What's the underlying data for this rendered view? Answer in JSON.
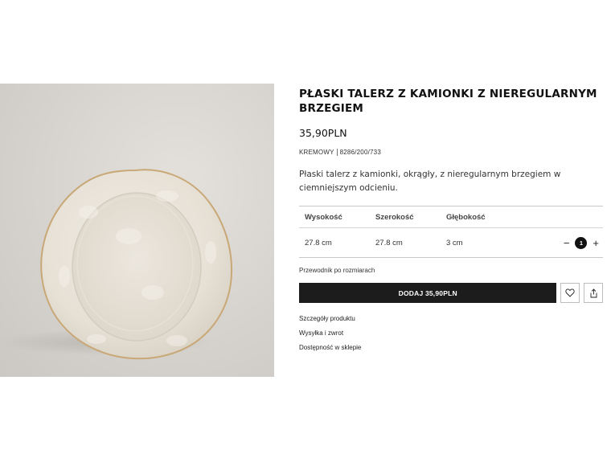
{
  "product": {
    "title": "PŁASKI TALERZ Z KAMIONKI Z NIEREGULARNYM BRZEGIEM",
    "price": "35,90PLN",
    "color": "KREMOWY",
    "reference": "8286/200/733",
    "description": "Płaski talerz z kamionki, okrągły, z nieregularnym brzegiem w ciemniejszym odcieniu."
  },
  "dimensions": {
    "headers": [
      "Wysokość",
      "Szerokość",
      "Głębokość"
    ],
    "values": [
      "27.8 cm",
      "27.8 cm",
      "3 cm"
    ]
  },
  "quantity": {
    "minus": "−",
    "value": "1",
    "plus": "+"
  },
  "size_guide_label": "Przewodnik po rozmiarach",
  "add_button_label": "DODAJ 35,90PLN",
  "icons": {
    "wishlist": "heart-icon",
    "share": "share-icon"
  },
  "links": [
    "Szczegóły produktu",
    "Wysyłka i zwrot",
    "Dostępność w sklepie"
  ],
  "colors": {
    "accent": "#1c1c1c",
    "plate": "#eae5db",
    "plate_rim": "#c9a877"
  }
}
